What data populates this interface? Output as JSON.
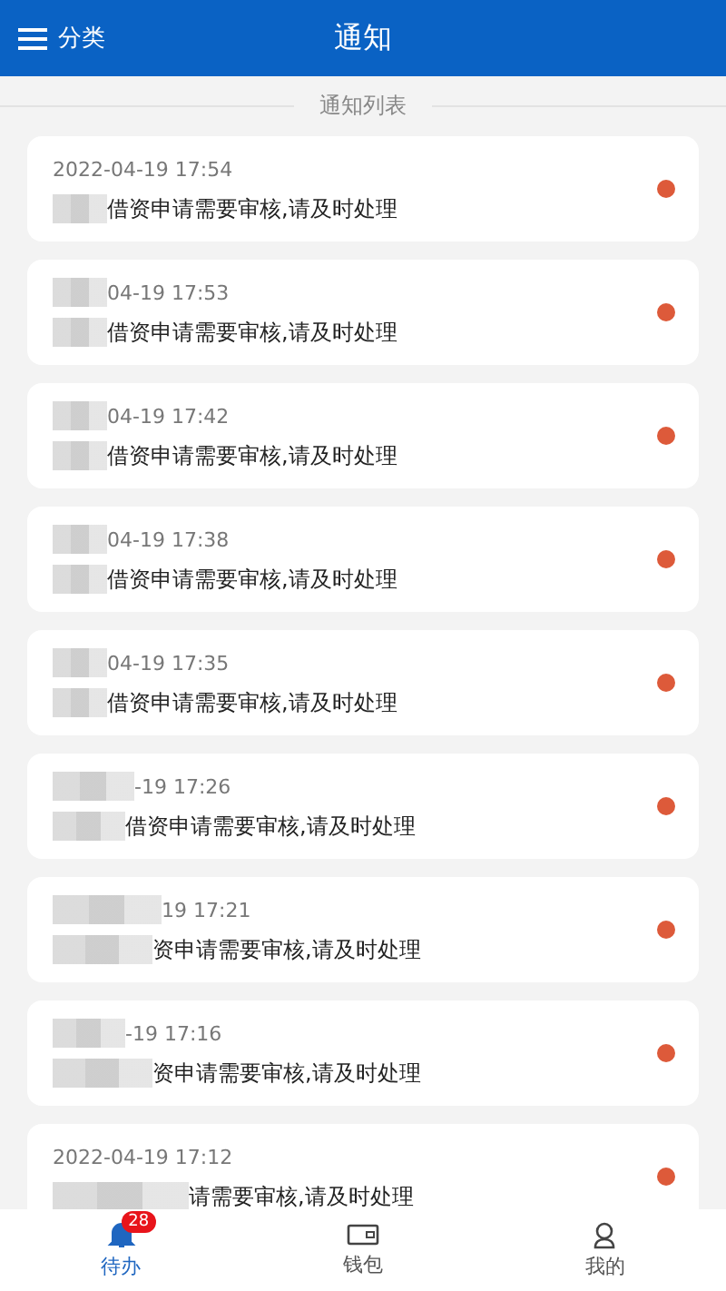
{
  "header": {
    "menu_label": "分类",
    "title": "通知"
  },
  "section_title": "通知列表",
  "notifications": [
    {
      "time": "2022-04-19 17:54",
      "message": "借资申请需要审核,请及时处理",
      "unread": true
    },
    {
      "time": "04-19 17:53",
      "message": "借资申请需要审核,请及时处理",
      "unread": true
    },
    {
      "time": "04-19 17:42",
      "message": "借资申请需要审核,请及时处理",
      "unread": true
    },
    {
      "time": "04-19 17:38",
      "message": "借资申请需要审核,请及时处理",
      "unread": true
    },
    {
      "time": "04-19 17:35",
      "message": "借资申请需要审核,请及时处理",
      "unread": true
    },
    {
      "time": "-19 17:26",
      "message": "借资申请需要审核,请及时处理",
      "unread": true
    },
    {
      "time": "19 17:21",
      "message": "资申请需要审核,请及时处理",
      "unread": true
    },
    {
      "time": "-19 17:16",
      "message": "资申请需要审核,请及时处理",
      "unread": true
    },
    {
      "time": "2022-04-19 17:12",
      "message": "请需要审核,请及时处理",
      "unread": true
    }
  ],
  "tabs": [
    {
      "kind": "bell",
      "label": "待办",
      "badge": "28",
      "selected": true
    },
    {
      "kind": "wallet",
      "label": "钱包",
      "selected": false
    },
    {
      "kind": "person",
      "label": "我的",
      "selected": false
    }
  ]
}
